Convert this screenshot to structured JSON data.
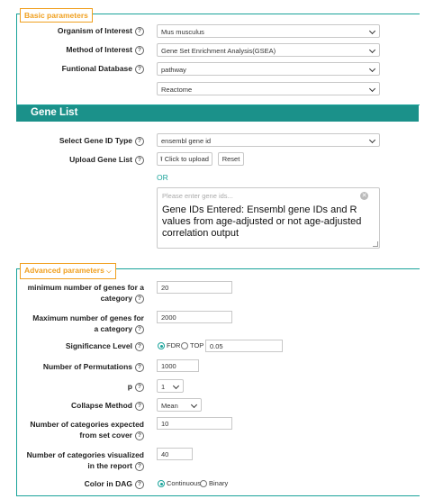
{
  "basic": {
    "legend": "Basic parameters",
    "organism_label": "Organism of Interest",
    "organism_value": "Mus musculus",
    "method_label": "Method of Interest",
    "method_value": "Gene Set Enrichment Analysis(GSEA)",
    "database_label": "Funtional Database",
    "database_value": "pathway",
    "database_sub_value": "Reactome"
  },
  "gene_list": {
    "title": "Gene List",
    "id_type_label": "Select Gene ID Type",
    "id_type_value": "ensembl gene id",
    "upload_label": "Upload Gene List",
    "upload_button": "Click to upload",
    "reset_button": "Reset",
    "or_text": "OR",
    "textarea_placeholder": "Please enter gene ids...",
    "textarea_note": "Gene IDs Entered: Ensembl gene IDs and R values from age-adjusted or not age-adjusted correlation output"
  },
  "advanced": {
    "legend": "Advanced parameters",
    "min_genes_label_1": "minimum number of genes for a",
    "min_genes_label_2": "category",
    "min_genes_value": "20",
    "max_genes_label_1": "Maximum number of genes for",
    "max_genes_label_2": "a category",
    "max_genes_value": "2000",
    "significance_label": "Significance Level",
    "fdr_label": "FDR",
    "top_label": "TOP",
    "significance_value": "0.05",
    "permutations_label": "Number of Permutations",
    "permutations_value": "1000",
    "p_label": "p",
    "p_value": "1",
    "collapse_label": "Collapse Method",
    "collapse_value": "Mean",
    "expected_label_1": "Number of categories expected",
    "expected_label_2": "from set cover",
    "expected_value": "10",
    "visualized_label_1": "Number of categories visualized",
    "visualized_label_2": "in the report",
    "visualized_value": "40",
    "dag_label": "Color in DAG",
    "continuous_label": "Continuous",
    "binary_label": "Binary"
  },
  "colors": {
    "accent": "#19a39a",
    "header_bar": "#1b918a",
    "legend": "#f0a020"
  }
}
